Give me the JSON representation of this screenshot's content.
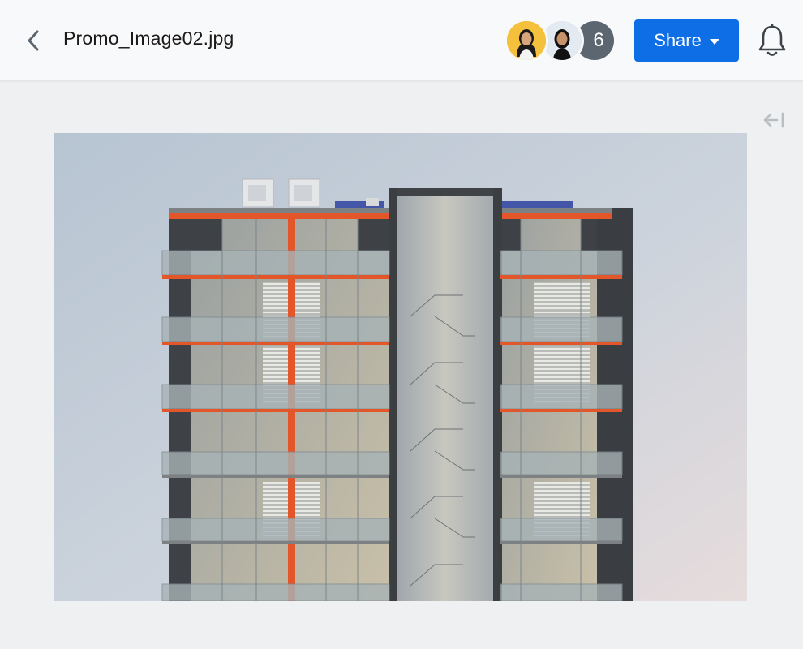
{
  "header": {
    "filename": "Promo_Image02.jpg",
    "back_icon": "chevron-left-icon",
    "avatars": [
      {
        "name": "avatar-user-1",
        "bg": "#f5c13d"
      },
      {
        "name": "avatar-user-2",
        "bg": "#dfe7ef"
      }
    ],
    "collaborator_count": "6",
    "share_label": "Share",
    "share_color": "#0d6ee6",
    "bell_icon": "bell-icon"
  },
  "viewer": {
    "collapse_icon": "collapse-sidebar-icon",
    "image_subject": "building-render"
  }
}
